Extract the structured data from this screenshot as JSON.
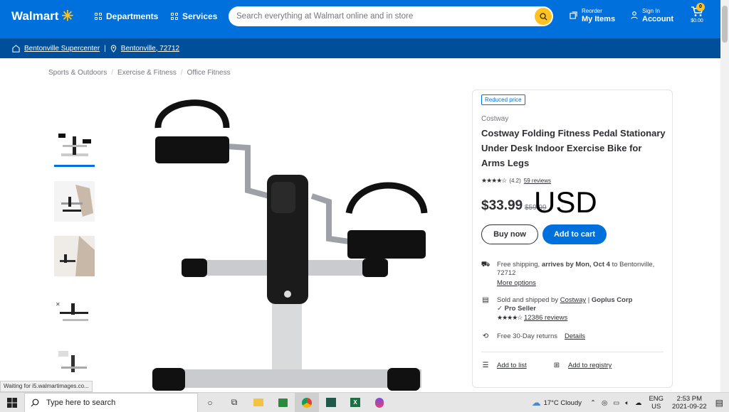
{
  "header": {
    "logo": "Walmart",
    "departments": "Departments",
    "services": "Services",
    "search_placeholder": "Search everything at Walmart online and in store",
    "reorder_top": "Reorder",
    "reorder_bottom": "My Items",
    "signin_top": "Sign In",
    "signin_bottom": "Account",
    "cart_count": "0",
    "cart_total": "$0.00"
  },
  "location": {
    "store": "Bentonville Supercenter",
    "city": "Bentonville, 72712"
  },
  "breadcrumb": [
    "Sports & Outdoors",
    "Exercise & Fitness",
    "Office Fitness"
  ],
  "product": {
    "badge": "Reduced price",
    "brand": "Costway",
    "title": "Costway Folding Fitness Pedal Stationary Under Desk Indoor Exercise Bike for Arms Legs",
    "rating": "(4.2)",
    "reviews": "59 reviews",
    "price": "$33.99",
    "was_price": "$59.99",
    "overlay": "USD",
    "buy_now": "Buy now",
    "add_to_cart": "Add to cart",
    "shipping_prefix": "Free shipping, ",
    "shipping_bold": "arrives by Mon, Oct 4",
    "shipping_suffix": " to Bentonville, 72712",
    "more_options": "More options",
    "seller_prefix": "Sold and shipped by ",
    "seller": "Costway",
    "seller_sep": " | ",
    "seller_corp": "Goplus Corp",
    "pro_seller": "Pro Seller",
    "seller_reviews": "12386 reviews",
    "returns": "Free 30-Day returns",
    "details": "Details",
    "add_list": "Add to list",
    "add_registry": "Add to registry"
  },
  "status_bar": "Waiting for i5.walmartimages.co...",
  "taskbar": {
    "search": "Type here to search",
    "weather": "17°C  Cloudy",
    "lang_top": "ENG",
    "lang_bottom": "US",
    "time": "2:53 PM",
    "date": "2021-09-22"
  },
  "colors": {
    "brand_blue": "#0071dc",
    "dark_blue": "#004f9a",
    "spark_yellow": "#ffc220"
  }
}
